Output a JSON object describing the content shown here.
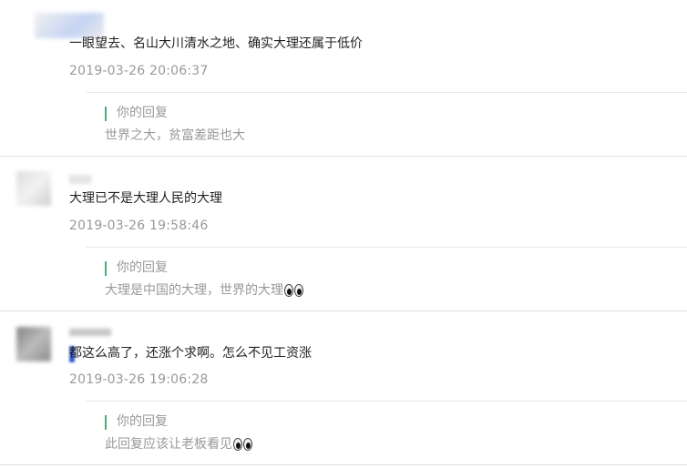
{
  "comments": [
    {
      "content": "一眼望去、名山大川清水之地、确实大理还属于低价",
      "time": "2019-03-26 20:06:37",
      "reply_label": "你的回复",
      "reply_text": "世界之大，贫富差距也大",
      "avatar_color": "#9fb6ec"
    },
    {
      "content": "大理已不是大理人民的大理",
      "time": "2019-03-26 19:58:46",
      "reply_label": "你的回复",
      "reply_text": "大理是中国的大理，世界的大理",
      "avatar_color": "#cccccc"
    },
    {
      "content": "都这么高了，还涨个求啊。怎么不见工资涨",
      "time": "2019-03-26 19:06:28",
      "reply_label": "你的回复",
      "reply_text": "此回复应该让老板看见",
      "avatar_color": "#8a8a8a"
    }
  ],
  "colors": {
    "reply_bar": "#3cb371",
    "time_text": "#999999",
    "content_text": "#222222"
  }
}
